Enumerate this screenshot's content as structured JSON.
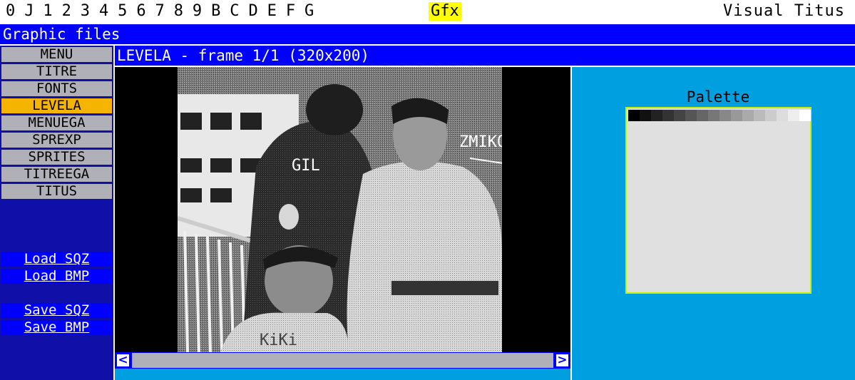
{
  "topbar": {
    "tabs": [
      "0",
      "J",
      "1",
      "2",
      "3",
      "4",
      "5",
      "6",
      "7",
      "8",
      "9",
      "B",
      "C",
      "D",
      "E",
      "F",
      "G"
    ],
    "gfx_label": "Gfx",
    "app_title": "Visual Titus"
  },
  "section_header": "Graphic files",
  "sidebar": {
    "items": [
      {
        "label": "MENU",
        "active": false
      },
      {
        "label": "TITRE",
        "active": false
      },
      {
        "label": "FONTS",
        "active": false
      },
      {
        "label": "LEVELA",
        "active": true
      },
      {
        "label": "MENUEGA",
        "active": false
      },
      {
        "label": "SPREXP",
        "active": false
      },
      {
        "label": "SPRITES",
        "active": false
      },
      {
        "label": "TITREEGA",
        "active": false
      },
      {
        "label": "TITUS",
        "active": false
      }
    ],
    "buttons": {
      "load_sqz": "Load SQZ",
      "load_bmp": "Load BMP",
      "save_sqz": "Save SQZ",
      "save_bmp": "Save BMP"
    }
  },
  "frame_header": "LEVELA - frame 1/1 (320x200)",
  "canvas": {
    "image_labels": {
      "gil": "GIL",
      "zmiko": "ZMIKO",
      "kiki": "KiKi"
    }
  },
  "scrollbar": {
    "left_arrow": "<",
    "right_arrow": ">"
  },
  "palette": {
    "title": "Palette",
    "colors": [
      "#000000",
      "#111111",
      "#222222",
      "#333333",
      "#444444",
      "#555555",
      "#666666",
      "#777777",
      "#888888",
      "#999999",
      "#aaaaaa",
      "#bbbbbb",
      "#cccccc",
      "#dddddd",
      "#eeeeee",
      "#ffffff"
    ]
  },
  "colors": {
    "header_blue": "#0000ff",
    "sidebar_navy": "#1010a8",
    "active_item": "#f4b400",
    "inactive_item": "#b0b0b8",
    "panel_cyan": "#00a0e0",
    "gfx_highlight": "#ffff00"
  }
}
